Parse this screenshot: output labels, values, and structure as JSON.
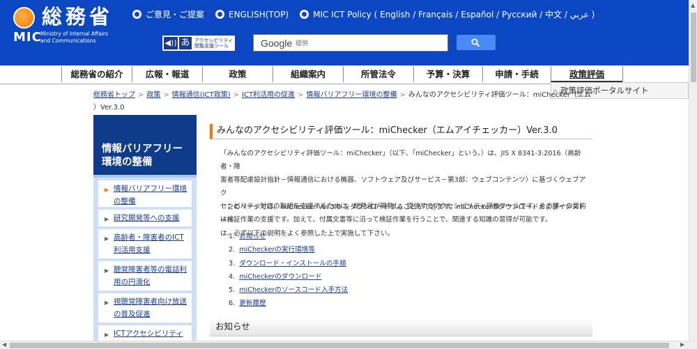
{
  "header": {
    "logo_kanji": "総務省",
    "logo_mic": "MIC",
    "logo_english_line1": "Ministry of Internal Affairs",
    "logo_english_line2": "and Communications",
    "top_links": [
      "ご意見・ご提案",
      "ENGLISH(TOP)",
      "MIC ICT Policy ( English / Français / Español / Русский / 中文 / عربي )"
    ],
    "accessibility_tool_icon1": "◀))",
    "accessibility_tool_icon2": "あ",
    "accessibility_tool_label_line1": "アクセシビリティ",
    "accessibility_tool_label_line2": "閲覧支援ツール",
    "search_brand": "Google",
    "search_suffix": "提供",
    "search_value": ""
  },
  "nav": {
    "items": [
      "総務省の紹介",
      "広報・報道",
      "政策",
      "組織案内",
      "所管法令",
      "予算・決算",
      "申請・手続",
      "政策評価"
    ],
    "active_index": 7,
    "dropdown_chevron": "»",
    "dropdown_item": "政策評価ポータルサイト"
  },
  "breadcrumb": {
    "links": [
      "総務省トップ",
      "政策",
      "情報通信(ICT政策)",
      "ICT利活用の促進",
      "情報バリアフリー環境の整備"
    ],
    "separator": ">",
    "current_part1": "みんなのアクセシビリティ評価ツール：miChecker（エム",
    "current_part2": "）Ver.3.0"
  },
  "sidebar": {
    "title": "情報バリアフリー環境の整備",
    "marker": "▶",
    "items": [
      "情報バリアフリー環境の整備",
      "研究開発等への支援",
      "高齢者・障害者のICT利活用支援",
      "聴覚障害者等の電話利用の円滑化",
      "視聴覚障害者向け放送の普及促進",
      "ICTアクセシビリティの"
    ]
  },
  "content": {
    "title": "みんなのアクセシビリティ評価ツール：miChecker（エムアイチェッカー）Ver.3.0",
    "intro_lines": [
      "「みんなのアクセシビリティ評価ツール：miChecker」（以下、「miChecker」という。）は、JIS X 8341-3:2016（高齢者・障",
      "害者等配慮設計指針－情報通信における機器、ソフトウェア及びサービス－第3部：ウェブコンテンツ）に基づくウェブアク",
      "セシビリティ対応の取組を支援するために、総務省が開発し、提供するアクセシビリティ評価ツールです。その第一の目的",
      "は検証作業の支援です。加えて、付属文書等に沿って検証作業を行うことで、関連する知識の習得が可能です。"
    ],
    "download_lines": [
      "　このページでは、miChecker Ver.3.0 をダウンロードすることができます。miCheckerのダウンロードおよびインストール",
      "は、必ず以下の説明をよく参照した上で実施して下さい。"
    ],
    "toc": [
      "お知らせ",
      "miCheckerの実行環境等",
      "ダウンロード・インストールの手順",
      "miCheckerのダウンロード",
      "miCheckerのソースコード入手方法",
      "更新履歴"
    ],
    "section_heading": "お知らせ"
  },
  "scrollbar": {
    "up": "▲",
    "left": "◀",
    "right": "▶"
  },
  "colors": {
    "header_blue": "#0b47c3",
    "accent_orange": "#f07800",
    "sidebar_navy": "#0f3c8a",
    "sidebar_bg": "#cde0f4",
    "link": "#1a3c8f"
  }
}
